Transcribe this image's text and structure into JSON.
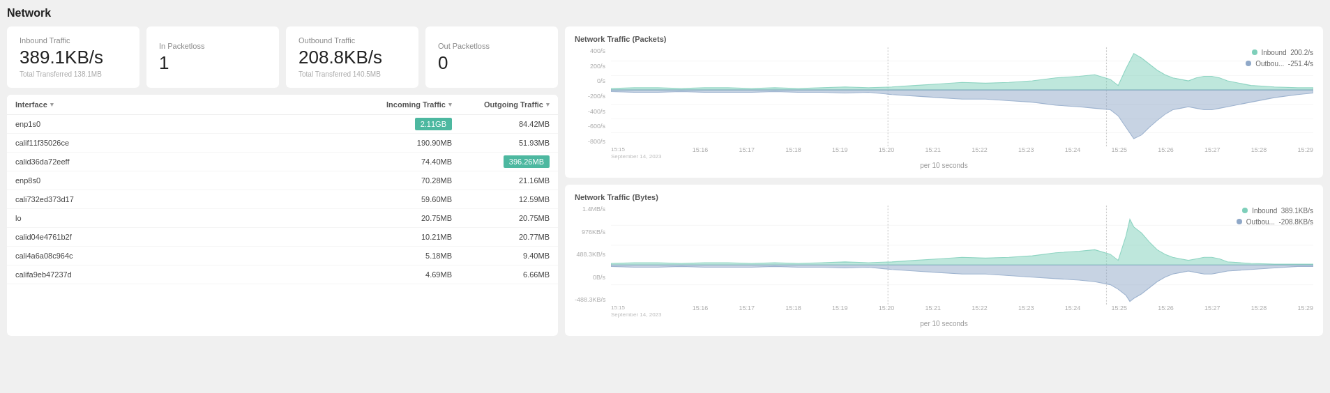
{
  "page": {
    "title": "Network"
  },
  "stat_cards": [
    {
      "label": "Inbound Traffic",
      "value": "389.1KB/s",
      "sub": "Total Transferred 138.1MB"
    },
    {
      "label": "In Packetloss",
      "value": "1",
      "sub": ""
    },
    {
      "label": "Outbound Traffic",
      "value": "208.8KB/s",
      "sub": "Total Transferred 140.5MB"
    },
    {
      "label": "Out Packetloss",
      "value": "0",
      "sub": ""
    }
  ],
  "table": {
    "col_interface": "Interface",
    "col_incoming": "Incoming Traffic",
    "col_outgoing": "Outgoing Traffic",
    "rows": [
      {
        "interface": "enp1s0",
        "incoming": "2.11GB",
        "outgoing": "84.42MB",
        "incoming_highlight": true,
        "outgoing_highlight": false
      },
      {
        "interface": "calif11f35026ce",
        "incoming": "190.90MB",
        "outgoing": "51.93MB",
        "incoming_highlight": false,
        "outgoing_highlight": false
      },
      {
        "interface": "calid36da72eeff",
        "incoming": "74.40MB",
        "outgoing": "396.26MB",
        "incoming_highlight": false,
        "outgoing_highlight": true
      },
      {
        "interface": "enp8s0",
        "incoming": "70.28MB",
        "outgoing": "21.16MB",
        "incoming_highlight": false,
        "outgoing_highlight": false
      },
      {
        "interface": "cali732ed373d17",
        "incoming": "59.60MB",
        "outgoing": "12.59MB",
        "incoming_highlight": false,
        "outgoing_highlight": false
      },
      {
        "interface": "lo",
        "incoming": "20.75MB",
        "outgoing": "20.75MB",
        "incoming_highlight": false,
        "outgoing_highlight": false
      },
      {
        "interface": "calid04e4761b2f",
        "incoming": "10.21MB",
        "outgoing": "20.77MB",
        "incoming_highlight": false,
        "outgoing_highlight": false
      },
      {
        "interface": "cali4a6a08c964c",
        "incoming": "5.18MB",
        "outgoing": "9.40MB",
        "incoming_highlight": false,
        "outgoing_highlight": false
      },
      {
        "interface": "califa9eb47237d",
        "incoming": "4.69MB",
        "outgoing": "6.66MB",
        "incoming_highlight": false,
        "outgoing_highlight": false
      }
    ]
  },
  "chart_packets": {
    "title": "Network Traffic (Packets)",
    "legend_inbound_label": "Inbound",
    "legend_inbound_value": "200.2/s",
    "legend_outbound_label": "Outbou...",
    "legend_outbound_value": "-251.4/s",
    "y_labels": [
      "400/s",
      "200/s",
      "0/s",
      "-200/s",
      "-400/s",
      "-600/s",
      "-800/s"
    ],
    "x_labels": [
      "15:15\nSeptember 14, 2023",
      "15:16",
      "15:17",
      "15:18",
      "15:19",
      "15:20",
      "15:21",
      "15:22",
      "15:23",
      "15:24",
      "15:25",
      "15:26",
      "15:27",
      "15:28",
      "15:29"
    ],
    "footer": "per 10 seconds"
  },
  "chart_bytes": {
    "title": "Network Traffic (Bytes)",
    "legend_inbound_label": "Inbound",
    "legend_inbound_value": "389.1KB/s",
    "legend_outbound_label": "Outbou...",
    "legend_outbound_value": "-208.8KB/s",
    "y_labels": [
      "1.4MB/s",
      "976KB/s",
      "488.3KB/s",
      "0B/s",
      "-488.3KB/s"
    ],
    "x_labels": [
      "15:15\nSeptember 14, 2023",
      "15:16",
      "15:17",
      "15:18",
      "15:19",
      "15:20",
      "15:21",
      "15:22",
      "15:23",
      "15:24",
      "15:25",
      "15:26",
      "15:27",
      "15:28",
      "15:29"
    ],
    "footer": "per 10 seconds"
  },
  "icons": {
    "chevron_down": "▾",
    "sort": "⇅"
  }
}
